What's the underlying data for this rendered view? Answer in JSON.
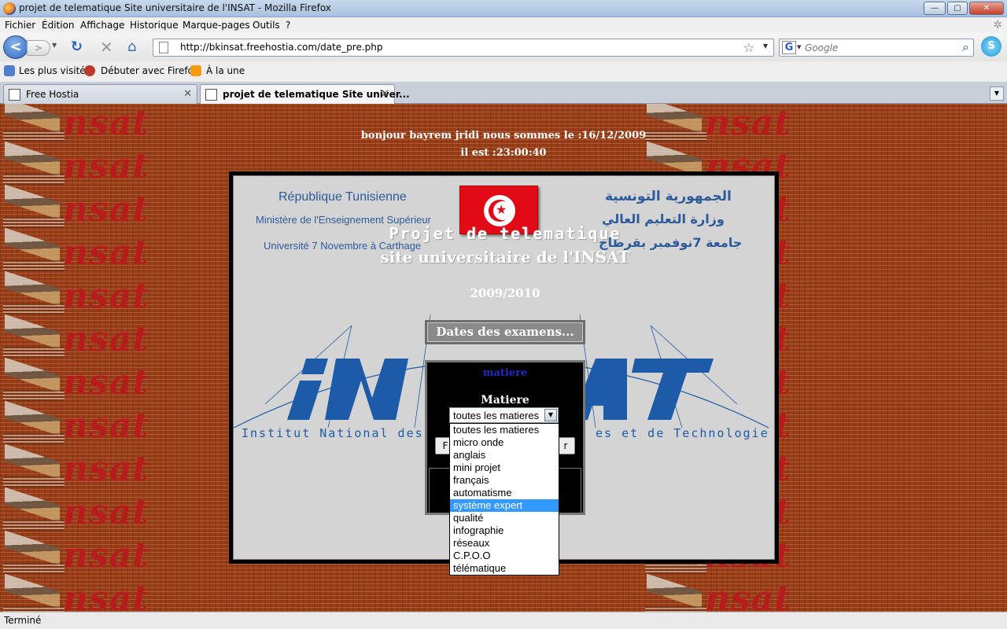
{
  "window": {
    "title": "projet de telematique Site universitaire de l'INSAT - Mozilla Firefox",
    "controls": {
      "minimize": "—",
      "maximize": "▢",
      "close": "✕"
    }
  },
  "menu": [
    "Fichier",
    "Édition",
    "Affichage",
    "Historique",
    "Marque-pages",
    "Outils",
    "?"
  ],
  "nav": {
    "url": "http://bkinsat.freehostia.com/date_pre.php",
    "search_placeholder": "Google",
    "search_engine_letter": "G",
    "skype_letter": "S"
  },
  "bookmarks": [
    "Les plus visités",
    "Débuter avec Firefox",
    "À la une"
  ],
  "tabs": [
    {
      "label": "Free Hostia",
      "active": false
    },
    {
      "label": "projet de telematique Site univer...",
      "active": true
    }
  ],
  "page": {
    "greeting_line1": "bonjour bayrem jridi nous sommes le :16/12/2009",
    "greeting_line2": "il est :23:00:40",
    "header": {
      "fr_country": "République Tunisienne",
      "fr_ministry": "Ministère de l'Enseignement Supérieur",
      "fr_university": "Université 7 Novembre à Carthage",
      "ar_country": "الجمهورية التونسية",
      "ar_ministry": "وزارة التعليم العالي",
      "ar_university": "جامعة 7نوفمبر بقرطاج"
    },
    "project_title_line1": "Projet de telematique",
    "project_title_line2": "site universitaire de l'INSAT",
    "year": "2009/2010",
    "dates_button": "Dates des examens...",
    "insat_logo_text": "INSAT",
    "institute_name_left": "Institut National des",
    "institute_name_right": "es et de Technologie",
    "form": {
      "header": "matiere",
      "label": "Matiere",
      "selected": "toutes les matieres",
      "button_left_partial": "F",
      "button_right_partial": "r",
      "options": [
        "toutes les matieres",
        "micro onde",
        "anglais",
        "mini projet",
        "français",
        "automatisme",
        "système expert",
        "qualité",
        "infographie",
        "réseaux",
        "C.P.O.O",
        "télématique"
      ],
      "highlighted_option": "système expert"
    },
    "side_logo_word": "nsat"
  },
  "status": "Terminé",
  "colors": {
    "page_bg": "#9a3d17",
    "panel_bg": "#d4d4d4",
    "accent_blue": "#1d5ba8",
    "highlight": "#3399ff",
    "flag_red": "#e30a17"
  }
}
